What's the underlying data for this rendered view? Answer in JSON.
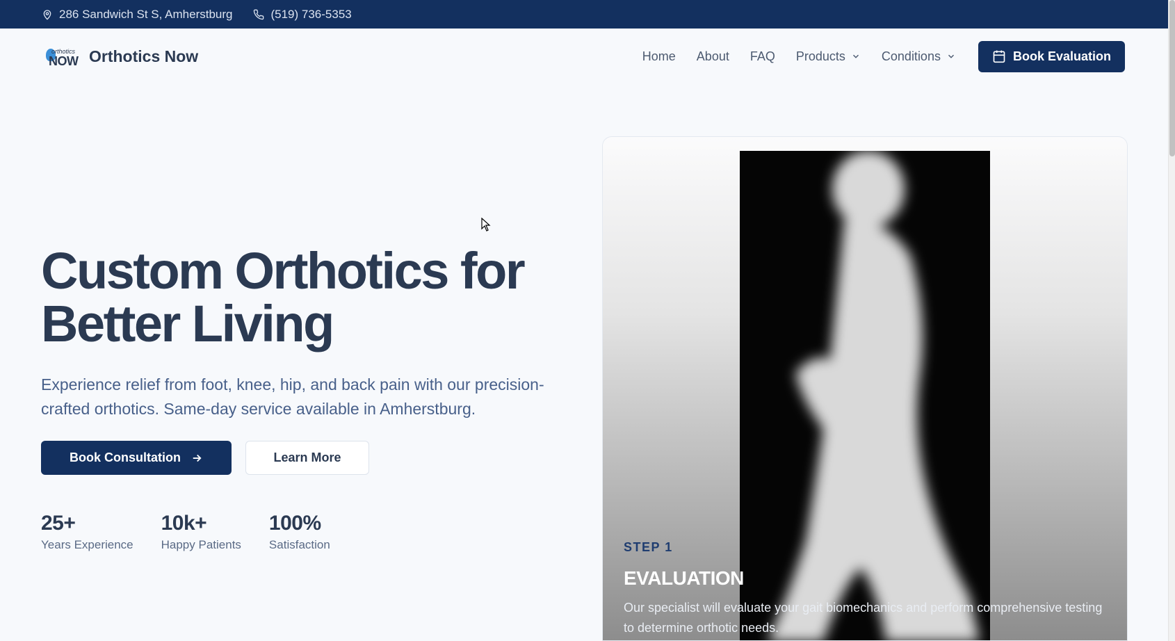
{
  "topbar": {
    "address": "286 Sandwich St S, Amherstburg",
    "phone": "(519) 736-5353",
    "address_icon": "map-pin-icon",
    "phone_icon": "phone-icon"
  },
  "nav": {
    "logo_small": "orthotics",
    "logo_now": "NOW",
    "brand": "Orthotics Now",
    "links": [
      "Home",
      "About",
      "FAQ",
      "Products",
      "Conditions"
    ],
    "cta": "Book Evaluation",
    "cta_icon": "calendar-icon"
  },
  "hero": {
    "title": "Custom Orthotics for Better Living",
    "description": "Experience relief from foot, knee, hip, and back pain with our precision-crafted orthotics. Same-day service available in Amherstburg.",
    "primary_button": "Book Consultation",
    "secondary_button": "Learn More",
    "stats": [
      {
        "value": "25+",
        "label": "Years Experience"
      },
      {
        "value": "10k+",
        "label": "Happy Patients"
      },
      {
        "value": "100%",
        "label": "Satisfaction"
      }
    ]
  },
  "card": {
    "step": "STEP 1",
    "title": "EVALUATION",
    "description": "Our specialist will evaluate your gait biomechanics and perform comprehensive testing to determine orthotic needs."
  },
  "colors": {
    "navy": "#13305f",
    "text": "#2b3a52",
    "muted": "#48608a",
    "background": "#f7f9fc"
  }
}
